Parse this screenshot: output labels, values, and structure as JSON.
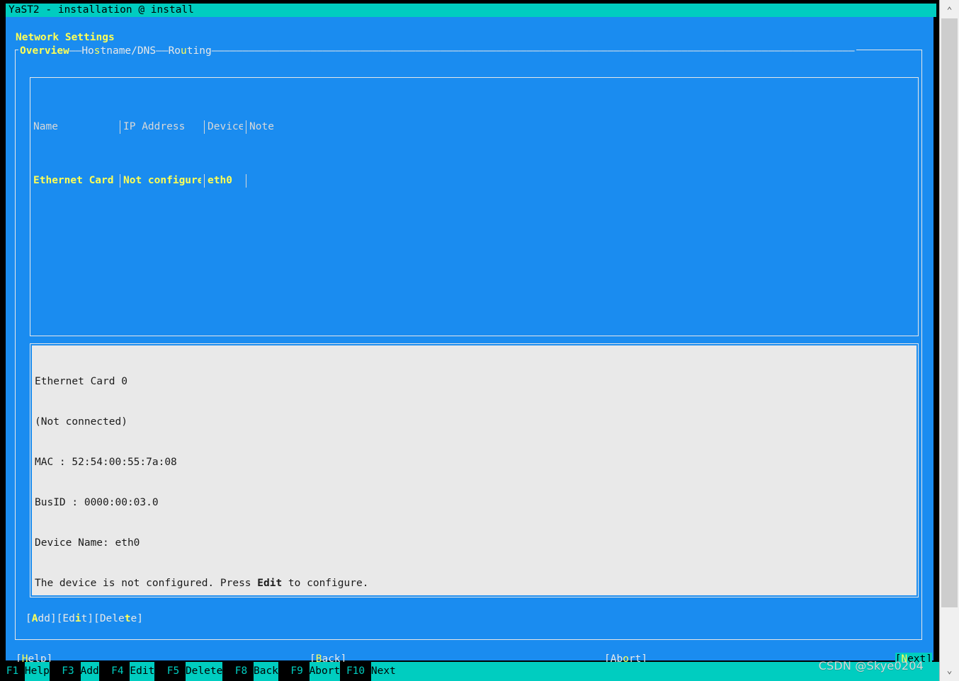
{
  "window": {
    "title": "YaST2 - installation @ install"
  },
  "dialog": {
    "heading": "Network Settings"
  },
  "tabs": {
    "items": [
      {
        "label": "Overview",
        "pre": "",
        "hot": "O",
        "post": "verview",
        "active": true
      },
      {
        "label": "Hostname/DNS",
        "pre": "Ho",
        "hot": "s",
        "post": "tname/DNS",
        "active": false
      },
      {
        "label": "Routing",
        "pre": "Ro",
        "hot": "u",
        "post": "ting",
        "active": false
      }
    ],
    "separator": "——"
  },
  "table": {
    "columns": [
      "Name",
      "IP Address",
      "Device",
      "Note"
    ],
    "rows": [
      {
        "name": "Ethernet Card 0",
        "ip": "Not configured",
        "device": "eth0",
        "note": "",
        "selected": true
      }
    ]
  },
  "detail": {
    "lines": [
      {
        "text": "Ethernet Card 0",
        "bold": false
      },
      {
        "text": "(Not connected)",
        "bold": false
      },
      {
        "text": "MAC : 52:54:00:55:7a:08",
        "bold": false
      },
      {
        "text": "BusID : 0000:00:03.0",
        "bold": false
      },
      {
        "text": "Device Name: eth0",
        "bold": false
      }
    ],
    "footer": {
      "pre": "The device is not configured. Press ",
      "bold": "Edit",
      "post": " to configure."
    }
  },
  "actions": [
    {
      "open": "[",
      "pre": "",
      "hot": "A",
      "post": "dd",
      "close": "]"
    },
    {
      "open": "[",
      "pre": "Ed",
      "hot": "i",
      "post": "t",
      "close": "]"
    },
    {
      "open": "[",
      "pre": "Dele",
      "hot": "t",
      "post": "e",
      "close": "]"
    }
  ],
  "dialog_buttons": [
    {
      "id": "help",
      "open": "[",
      "pre": "",
      "hot": "H",
      "post": "elp",
      "close": "]",
      "focused": false
    },
    {
      "id": "back",
      "open": "[",
      "pre": "",
      "hot": "B",
      "post": "ack",
      "close": "]",
      "focused": false
    },
    {
      "id": "abort",
      "open": "[",
      "pre": "Ab",
      "hot": "o",
      "post": "rt",
      "close": "]",
      "focused": false
    },
    {
      "id": "next",
      "open": "[",
      "pre": "",
      "hot": "N",
      "post": "ext",
      "close": "]",
      "focused": true
    }
  ],
  "function_keys": [
    {
      "key": "F1",
      "label": "Help"
    },
    {
      "key": "F3",
      "label": "Add"
    },
    {
      "key": "F4",
      "label": "Edit"
    },
    {
      "key": "F5",
      "label": "Delete"
    },
    {
      "key": "F8",
      "label": "Back"
    },
    {
      "key": "F9",
      "label": "Abort"
    },
    {
      "key": "F10",
      "label": "Next"
    }
  ],
  "scrollbar": {
    "up_icon": "chevron-up-icon",
    "down_icon": "chevron-down-icon",
    "up_glyph": "⌃",
    "down_glyph": "⌄"
  },
  "watermark": {
    "text": "CSDN @Skye0204"
  },
  "colors": {
    "panel_blue": "#1a8cf0",
    "accent_cyan": "#00cdc0",
    "highlight_yellow": "#ffff55",
    "frame_white": "#e8e8e8",
    "detail_bg": "#e9e9e9",
    "terminal_black": "#000000"
  }
}
